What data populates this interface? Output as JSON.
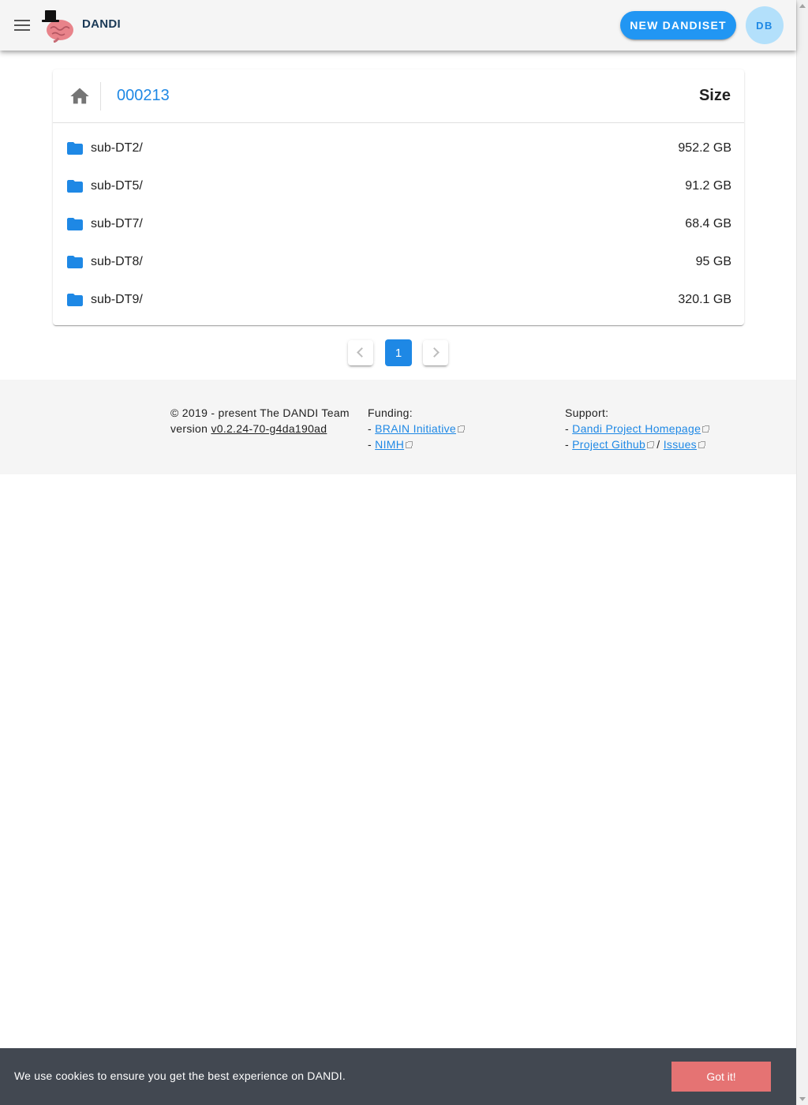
{
  "header": {
    "brand": "DANDI",
    "new_dandiset_label": "NEW DANDISET",
    "user_initials": "DB"
  },
  "browser": {
    "dandiset_id": "000213",
    "size_header": "Size",
    "rows": [
      {
        "name": "sub-DT2/",
        "size": "952.2 GB"
      },
      {
        "name": "sub-DT5/",
        "size": "91.2 GB"
      },
      {
        "name": "sub-DT7/",
        "size": "68.4 GB"
      },
      {
        "name": "sub-DT8/",
        "size": "95 GB"
      },
      {
        "name": "sub-DT9/",
        "size": "320.1 GB"
      }
    ]
  },
  "pagination": {
    "current_page": "1"
  },
  "footer": {
    "copyright": "© 2019 - present The DANDI Team",
    "version_prefix": "version",
    "version": "v0.2.24-70-g4da190ad",
    "funding_title": "Funding:",
    "funding_links": [
      "BRAIN Initiative",
      "NIMH"
    ],
    "support_title": "Support:",
    "support_homepage": "Dandi Project Homepage",
    "support_github": "Project Github",
    "support_separator": "/",
    "support_issues": "Issues",
    "dash": "-"
  },
  "cookie": {
    "message": "We use cookies to ensure you get the best experience on DANDI.",
    "button_label": "Got it!"
  },
  "colors": {
    "accent": "#2196f3",
    "link": "#1e88e5",
    "folder": "#1e88e5",
    "cookie_bg": "#424851",
    "cookie_button": "#e57373"
  }
}
